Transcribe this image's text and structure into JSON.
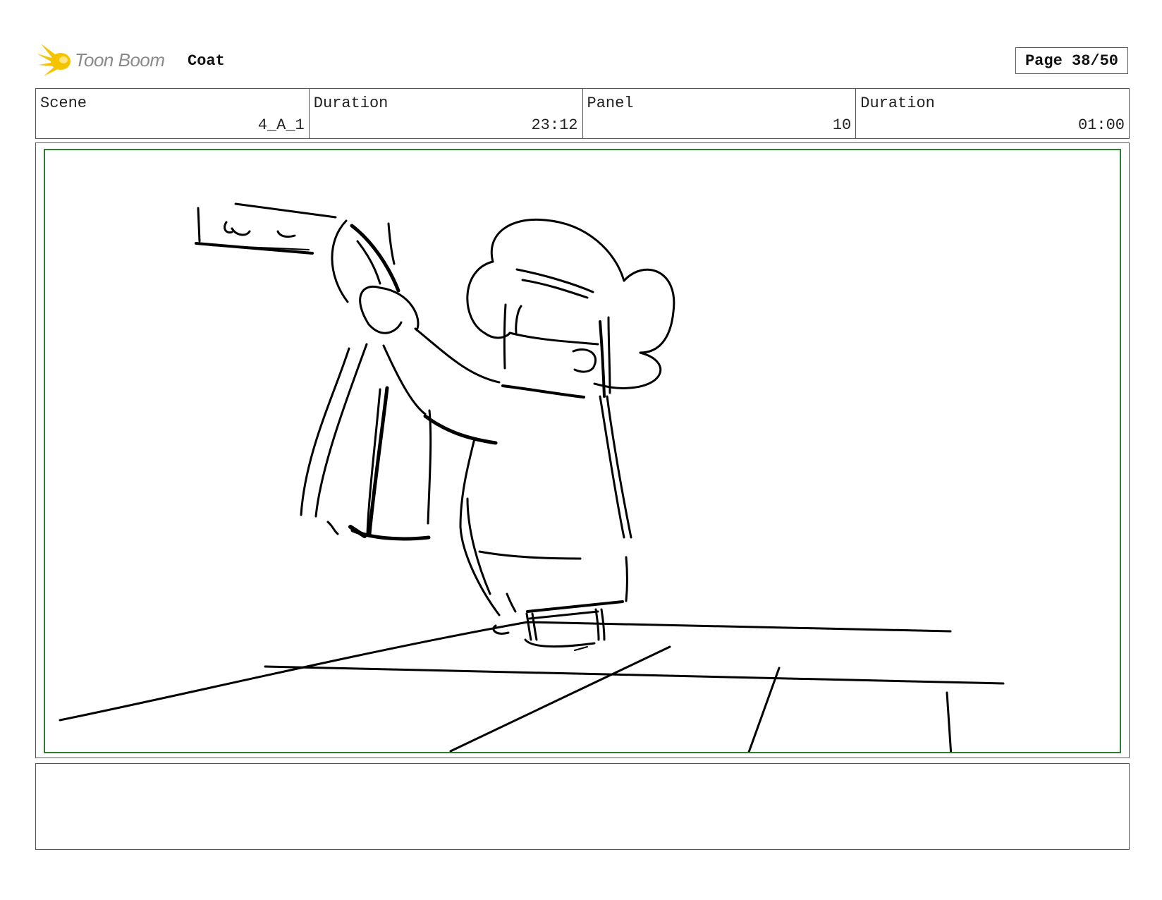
{
  "header": {
    "brand": "Toon Boom",
    "project_title": "Coat",
    "page_label": "Page",
    "page_value": "38/50",
    "logo_color": "#f5c400"
  },
  "info": {
    "scene_label": "Scene",
    "scene_value": "4_A_1",
    "scene_duration_label": "Duration",
    "scene_duration_value": "23:12",
    "panel_label": "Panel",
    "panel_value": "10",
    "panel_duration_label": "Duration",
    "panel_duration_value": "01:00"
  },
  "panel": {
    "frame_color": "#2e7d32",
    "sketch_color": "#000000"
  },
  "notes": {
    "text": ""
  }
}
